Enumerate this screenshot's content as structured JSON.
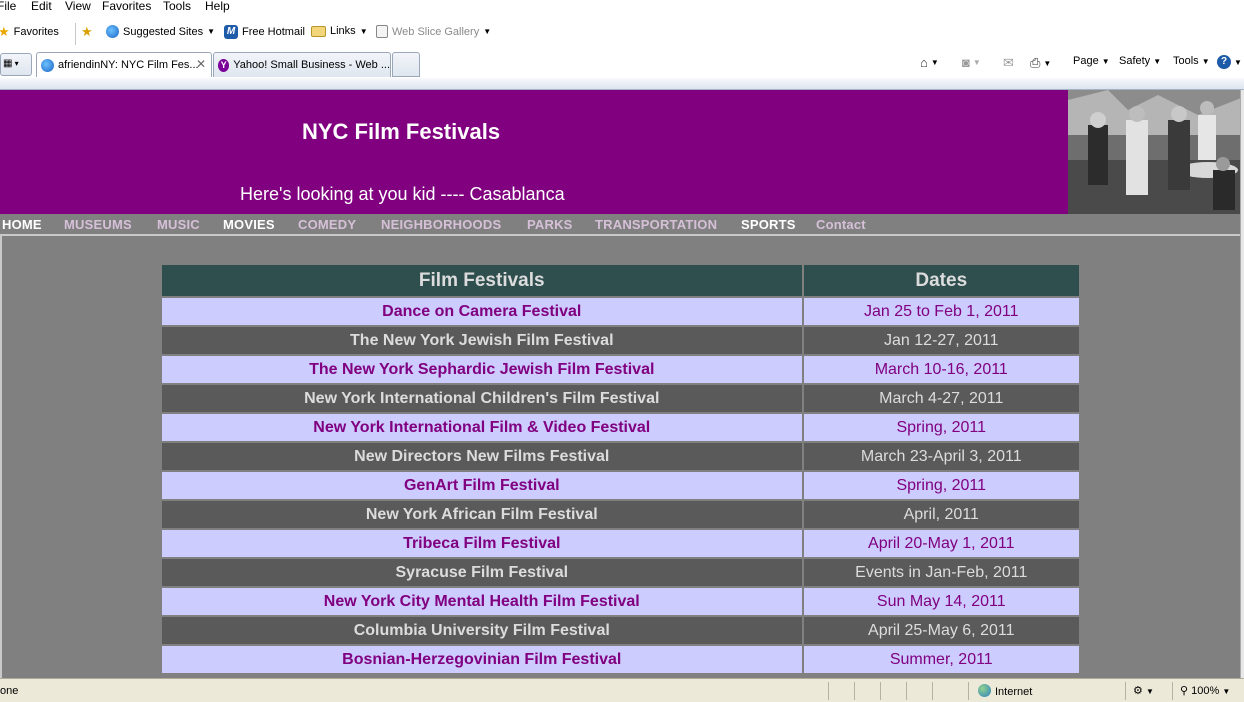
{
  "browser": {
    "menu": [
      "File",
      "Edit",
      "View",
      "Favorites",
      "Tools",
      "Help"
    ],
    "favorites_bar": {
      "favorites_label": "Favorites",
      "items": [
        "Suggested Sites",
        "Free Hotmail",
        "Links",
        "Web Slice Gallery"
      ]
    },
    "tabs": [
      {
        "title": "afriendinNY: NYC Film Fes...",
        "active": true
      },
      {
        "title": "Yahoo! Small Business - Web ...",
        "active": false
      }
    ],
    "command_bar": [
      "Page",
      "Safety",
      "Tools"
    ],
    "status": {
      "left_text": "one",
      "zone": "Internet",
      "zoom": "100%"
    }
  },
  "site": {
    "title": "NYC Film Festivals",
    "tagline": "Here's looking at you kid ---- Casablanca",
    "nav": [
      "HOME",
      "MUSEUMS",
      "MUSIC",
      "MOVIES",
      "COMEDY",
      "NEIGHBORHOODS",
      "PARKS",
      "TRANSPORTATION",
      "SPORTS",
      "Contact"
    ]
  },
  "table": {
    "headers": [
      "Film Festivals",
      "Dates"
    ],
    "rows": [
      {
        "name": "Dance on Camera Festival",
        "dates": "Jan 25 to Feb 1, 2011"
      },
      {
        "name": "The New York Jewish Film Festival",
        "dates": "Jan 12-27, 2011"
      },
      {
        "name": "The New York Sephardic Jewish Film Festival",
        "dates": "March 10-16, 2011"
      },
      {
        "name": "New York International Children's Film Festival",
        "dates": "March 4-27, 2011"
      },
      {
        "name": "New York International Film & Video Festival",
        "dates": "Spring, 2011"
      },
      {
        "name": "New Directors New Films Festival",
        "dates": "March 23-April 3, 2011"
      },
      {
        "name": "GenArt Film Festival",
        "dates": "Spring, 2011"
      },
      {
        "name": "New York African Film Festival",
        "dates": "April, 2011"
      },
      {
        "name": "Tribeca Film Festival",
        "dates": "April 20-May 1, 2011"
      },
      {
        "name": "Syracuse Film Festival",
        "dates": "Events in Jan-Feb, 2011"
      },
      {
        "name": "New York City Mental Health Film Festival",
        "dates": "Sun May 14, 2011"
      },
      {
        "name": "Columbia University Film Festival",
        "dates": "April 25-May 6, 2011"
      },
      {
        "name": "Bosnian-Herzegovinian Film Festival",
        "dates": "Summer, 2011"
      }
    ]
  },
  "colors": {
    "header_purple": "#800080",
    "table_header": "#2f4f4f",
    "row_light": "#ccccff",
    "row_dark": "#5a5a5a",
    "page_gray": "#808080"
  }
}
